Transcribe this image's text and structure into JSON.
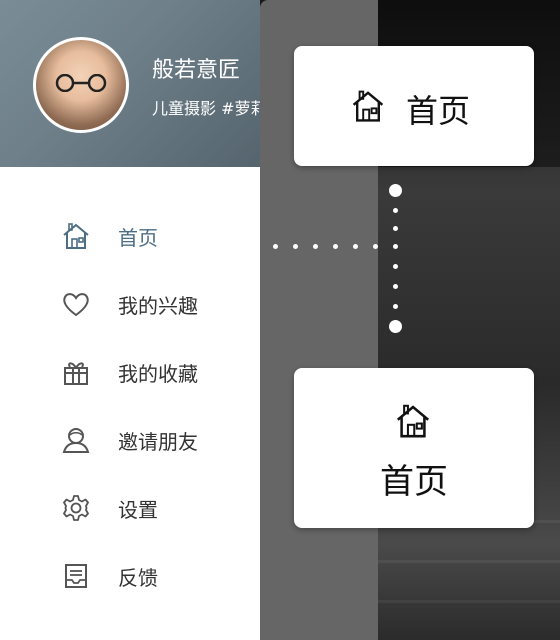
{
  "user": {
    "name": "般若意匠",
    "tagline": "儿童摄影 #萝莉#"
  },
  "menu": {
    "items": [
      {
        "label": "首页",
        "icon": "home-icon",
        "active": true
      },
      {
        "label": "我的兴趣",
        "icon": "heart-icon",
        "active": false
      },
      {
        "label": "我的收藏",
        "icon": "gift-icon",
        "active": false
      },
      {
        "label": "邀请朋友",
        "icon": "user-icon",
        "active": false
      },
      {
        "label": "设置",
        "icon": "gear-icon",
        "active": false
      },
      {
        "label": "反馈",
        "icon": "feedback-icon",
        "active": false
      }
    ]
  },
  "callouts": {
    "horizontal": {
      "label": "首页",
      "icon": "home-icon"
    },
    "vertical": {
      "label": "首页",
      "icon": "home-icon"
    }
  },
  "colors": {
    "active_accent": "#4d6d84",
    "header_bg": "#6d7e88",
    "overlay": "#666666"
  }
}
